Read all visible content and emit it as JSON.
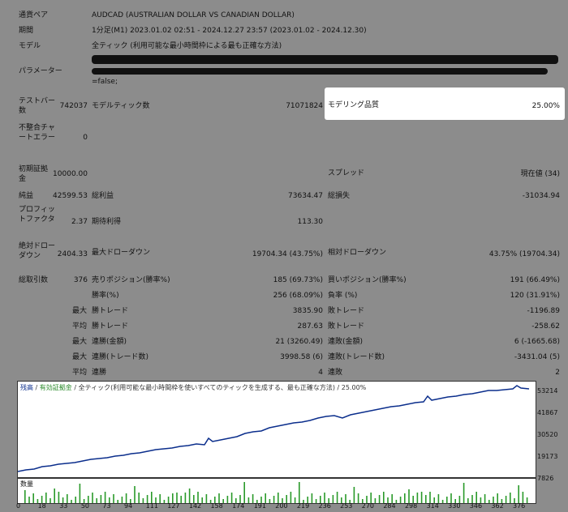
{
  "header": {
    "symbol_label": "通貨ペア",
    "symbol_value": "AUDCAD (AUSTRALIAN DOLLAR VS CANADIAN DOLLAR)",
    "period_label": "期間",
    "period_value": "1分足(M1) 2023.01.02 02:51 - 2024.12.27 23:57 (2023.01.02 - 2024.12.30)",
    "model_label": "モデル",
    "model_value": "全ティック (利用可能な最小時間枠による最も正確な方法)",
    "params_label": "パラメーター",
    "params_tail": "=false;"
  },
  "stats": {
    "test_bars_label": "テストバー数",
    "test_bars_value": "742037",
    "model_ticks_label": "モデルティック数",
    "model_ticks_value": "71071824",
    "modeling_quality_label": "モデリング品質",
    "modeling_quality_value": "25.00%",
    "mismatch_label": "不整合チャートエラー",
    "mismatch_value": "0",
    "initial_deposit_label": "初期証拠金",
    "initial_deposit_value": "10000.00",
    "spread_label": "スプレッド",
    "spread_value": "現在値 (34)",
    "net_profit_label": "純益",
    "net_profit_value": "42599.53",
    "gross_profit_label": "総利益",
    "gross_profit_value": "73634.47",
    "gross_loss_label": "総損失",
    "gross_loss_value": "-31034.94",
    "profit_factor_label": "プロフィットファクタ",
    "profit_factor_value": "2.37",
    "expected_payoff_label": "期待利得",
    "expected_payoff_value": "113.30",
    "abs_drawdown_label": "絶対ドローダウン",
    "abs_drawdown_value": "2404.33",
    "max_drawdown_label": "最大ドローダウン",
    "max_drawdown_value": "19704.34 (43.75%)",
    "rel_drawdown_label": "相対ドローダウン",
    "rel_drawdown_value": "43.75% (19704.34)",
    "total_trades_label": "総取引数",
    "total_trades_value": "376",
    "short_label": "売りポジション(勝率%)",
    "short_value": "185 (69.73%)",
    "long_label": "買いポジション(勝率%)",
    "long_value": "191 (66.49%)",
    "win_rate_label": "勝率(%)",
    "win_rate_value": "256 (68.09%)",
    "loss_rate_label": "負率 (%)",
    "loss_rate_value": "120 (31.91%)",
    "max_label": "最大",
    "avg_label": "平均",
    "largest_win_label": "勝トレード",
    "largest_win_value": "3835.90",
    "largest_loss_label": "敗トレード",
    "largest_loss_value": "-1196.89",
    "avg_win_label": "勝トレード",
    "avg_win_value": "287.63",
    "avg_loss_label": "敗トレード",
    "avg_loss_value": "-258.62",
    "max_consec_wins_money_label": "連勝(金額)",
    "max_consec_wins_money_value": "21 (3260.49)",
    "max_consec_losses_money_label": "連敗(金額)",
    "max_consec_losses_money_value": "6 (-1665.68)",
    "max_consec_profit_label": "連勝(トレード数)",
    "max_consec_profit_value": "3998.58 (6)",
    "max_consec_loss_label": "連敗(トレード数)",
    "max_consec_loss_value": "-3431.04 (5)",
    "avg_consec_wins_label": "連勝",
    "avg_consec_wins_value": "4",
    "avg_consec_losses_label": "連敗",
    "avg_consec_losses_value": "2"
  },
  "graph": {
    "legend_balance": "残高",
    "legend_equity": "有効証拠金",
    "legend_sep1": " / ",
    "legend_sep2": " / ",
    "legend_model": "全ティック(利用可能な最小時間枠を使いすべてのティックを生成する、最も正確な方法)",
    "legend_quality": " / 25.00%",
    "y_labels": [
      "53214",
      "41867",
      "30520",
      "19173",
      "7826"
    ],
    "volume_label": "数量",
    "x_labels": [
      "0",
      "18",
      "33",
      "50",
      "73",
      "94",
      "111",
      "127",
      "142",
      "158",
      "174",
      "191",
      "200",
      "219",
      "236",
      "253",
      "270",
      "284",
      "298",
      "314",
      "330",
      "346",
      "362",
      "376"
    ]
  },
  "colors": {
    "balance": "#0b2e8c",
    "volume": "#2a9a2a",
    "background": "#8c8c8c"
  }
}
